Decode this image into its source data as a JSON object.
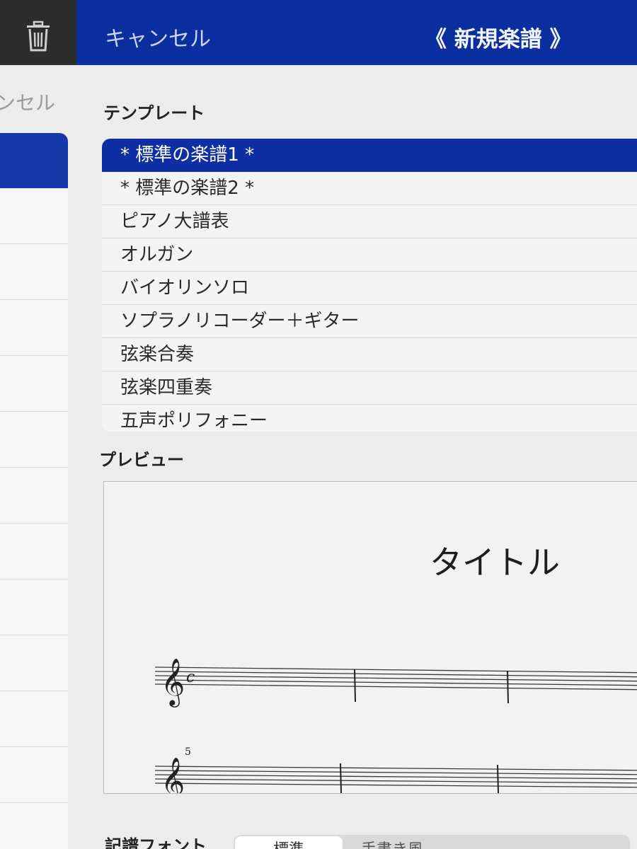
{
  "left_panel": {
    "cancel_fragment": "ンセル"
  },
  "navbar": {
    "cancel_label": "キャンセル",
    "title": "《 新規楽譜 》"
  },
  "template_section": {
    "label": "テンプレート",
    "items": [
      "* 標準の楽譜1 *",
      "* 標準の楽譜2 *",
      "ピアノ大譜表",
      "オルガン",
      "バイオリンソロ",
      "ソプラノリコーダー＋ギター",
      "弦楽合奏",
      "弦楽四重奏",
      "五声ポリフォニー"
    ],
    "selected_index": 0
  },
  "preview_section": {
    "label": "プレビュー",
    "score_title": "タイトル",
    "measure_number": "5",
    "time_signature": "c"
  },
  "notation_font": {
    "label": "記譜フォント",
    "options": [
      "標準",
      "手書き風"
    ],
    "selected": "標準"
  },
  "colors": {
    "nav_blue": "#0b2f9e",
    "selection_blue": "#0d2fa3"
  },
  "icons": {
    "delete": "trash-icon",
    "clef": "treble-clef-icon"
  }
}
